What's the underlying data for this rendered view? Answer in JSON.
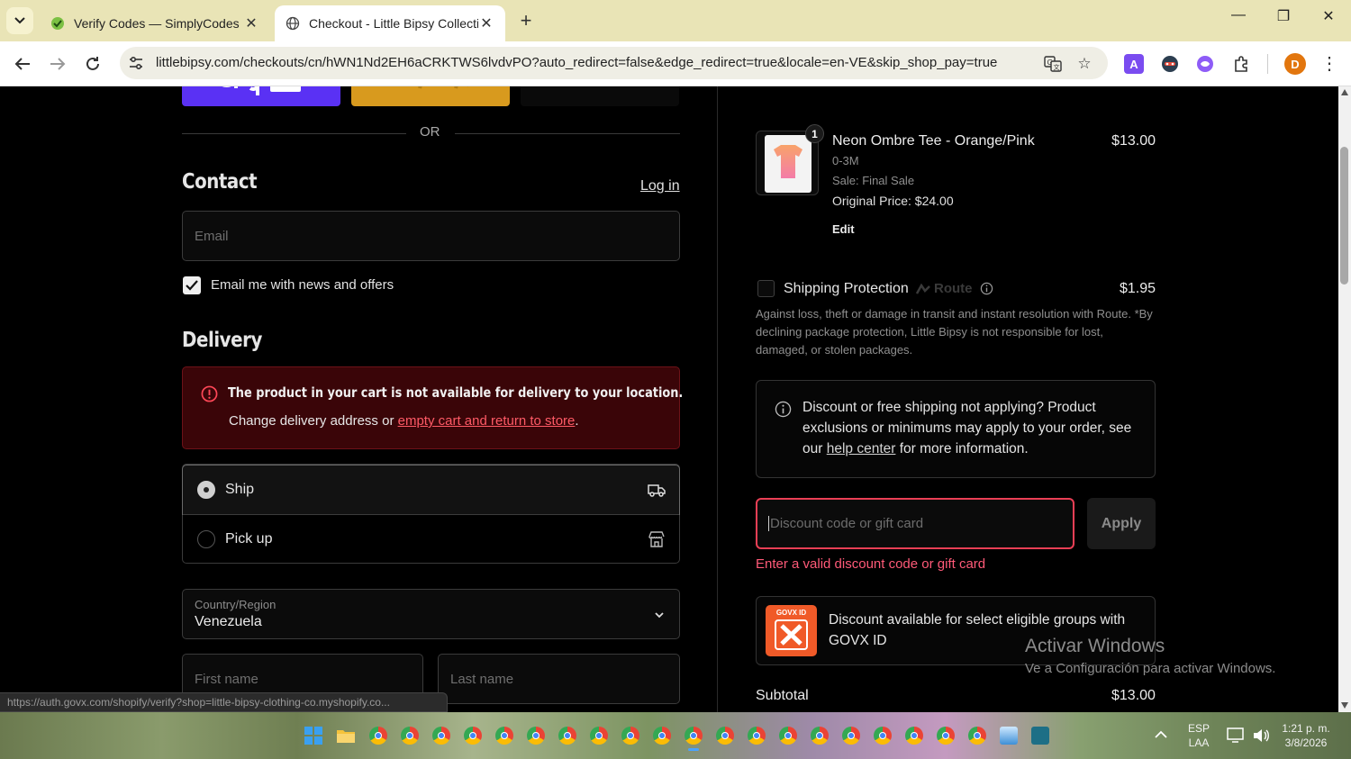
{
  "browser": {
    "tabs": [
      {
        "title": "Verify Codes — SimplyCodes",
        "active": false
      },
      {
        "title": "Checkout - Little Bipsy Collectio",
        "active": true
      }
    ],
    "url": "littlebipsy.com/checkouts/cn/hWN1Nd2EH6aCRKTWS6lvdvPO?auto_redirect=false&edge_redirect=true&locale=en-VE&skip_shop_pay=true",
    "profile_initial": "D",
    "extension_a": "A",
    "status_url": "https://auth.govx.com/shopify/verify?shop=little-bipsy-clothing-co.myshopify.co..."
  },
  "checkout": {
    "or_divider": "OR",
    "contact": {
      "heading": "Contact",
      "login_link": "Log in",
      "email_placeholder": "Email",
      "newsletter_label": "Email me with news and offers",
      "newsletter_checked": true
    },
    "delivery": {
      "heading": "Delivery",
      "error_title": "The product in your cart is not available for delivery to your location.",
      "error_body_prefix": "Change delivery address or ",
      "error_link": "empty cart and return to store",
      "error_body_suffix": ".",
      "options": [
        {
          "label": "Ship",
          "selected": true
        },
        {
          "label": "Pick up",
          "selected": false
        }
      ],
      "country_label": "Country/Region",
      "country_value": "Venezuela",
      "first_name_placeholder": "First name",
      "last_name_placeholder": "Last name"
    }
  },
  "summary": {
    "item": {
      "quantity": "1",
      "name": "Neon Ombre Tee - Orange/Pink",
      "size": "0-3M",
      "sale_note": "Sale: Final Sale",
      "original_price": "Original Price: $24.00",
      "edit_label": "Edit",
      "price": "$13.00"
    },
    "shipping_protection": {
      "label": "Shipping Protection",
      "brand": "Route",
      "price": "$1.95",
      "description": "Against loss, theft or damage in transit and instant resolution with Route. *By declining package protection, Little Bipsy is not responsible for lost, damaged, or stolen packages."
    },
    "discount_notice": {
      "text_prefix": "Discount or free shipping not applying? Product exclusions or minimums may apply to your order, see our ",
      "link": "help center",
      "text_suffix": " for more information."
    },
    "discount": {
      "placeholder": "Discount code or gift card",
      "apply_label": "Apply",
      "error": "Enter a valid discount code or gift card"
    },
    "govx": {
      "logo_text": "GOVX ID",
      "text": "Discount available for select eligible groups with GOVX ID"
    },
    "subtotal_label": "Subtotal",
    "subtotal_value": "$13.00"
  },
  "watermark": {
    "line1": "Activar Windows",
    "line2": "Ve a Configuración para activar Windows."
  },
  "taskbar": {
    "lang1": "ESP",
    "lang2": "LAA",
    "time": "1:21 p. m.",
    "date": "3/8/2026"
  },
  "colors": {
    "error_red": "#ff5a66",
    "error_bg": "#3a0508",
    "accent_input": "#ea3f55",
    "shop_pay": "#5a31f4",
    "paypal": "#ffc439",
    "profile": "#e2760e",
    "govx": "#f05a28"
  }
}
